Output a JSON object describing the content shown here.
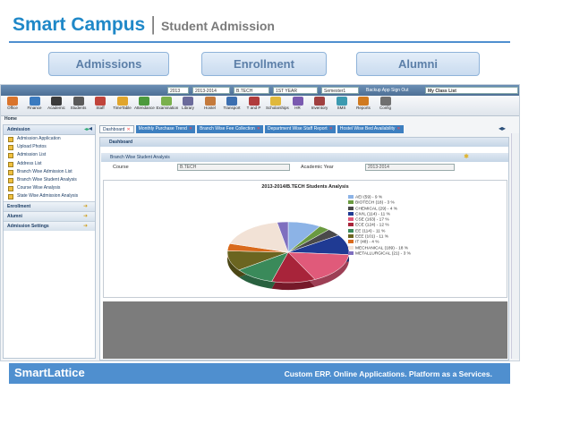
{
  "slide": {
    "brand": "Smart Campus",
    "separator": "|",
    "subtitle": "Student Admission",
    "pills": [
      "Admissions",
      "Enrollment",
      "Alumni"
    ],
    "footer_left": "SmartLattice",
    "footer_right": "Custom ERP. Online Applications. Platform as a Services."
  },
  "topbar": {
    "year1": "2013",
    "year2": "2013-2014",
    "course": "B.TECH",
    "year_level": "1ST YEAR",
    "semester": "Semester1",
    "backup": "Backup App",
    "signout": "Sign Out",
    "classlist": "My Class List"
  },
  "toolbar": [
    {
      "label": "Office",
      "color": "#d9742c"
    },
    {
      "label": "Finance",
      "color": "#3a7abf"
    },
    {
      "label": "Academic",
      "color": "#3b3b3b"
    },
    {
      "label": "Students",
      "color": "#5a5a5a"
    },
    {
      "label": "Staff",
      "color": "#c0443b"
    },
    {
      "label": "TimeTable",
      "color": "#e0a52c"
    },
    {
      "label": "Attendance",
      "color": "#4c9a3c"
    },
    {
      "label": "Examination",
      "color": "#7ab04c"
    },
    {
      "label": "Library",
      "color": "#6b6b9b"
    },
    {
      "label": "Hostel",
      "color": "#c47a3c"
    },
    {
      "label": "Transport",
      "color": "#3c6fb0"
    },
    {
      "label": "T and P",
      "color": "#b03c3c"
    },
    {
      "label": "Scholarships",
      "color": "#e0b83c"
    },
    {
      "label": "HR",
      "color": "#7a5ab0"
    },
    {
      "label": "Inventory",
      "color": "#a04040"
    },
    {
      "label": "SMS",
      "color": "#3c9ab0"
    },
    {
      "label": "Reports",
      "color": "#d07a20"
    },
    {
      "label": "Config",
      "color": "#707070"
    }
  ],
  "breadcrumb": "Home",
  "sidebar": {
    "header": "Admission",
    "items": [
      "Admission Application",
      "Upload Photos",
      "Admission List",
      "Address List",
      "Branch Wise Admission List",
      "Branch Wise Student Analysis",
      "Course Wise Analysis",
      "State Wise Admission Analysis"
    ],
    "groups": [
      "Enrollment",
      "Alumni",
      "Admission Settings"
    ]
  },
  "tabs": [
    {
      "label": "Dashboard",
      "active": true
    },
    {
      "label": "Monthly Purchase Trend",
      "active": false
    },
    {
      "label": "Branch Wise Fee Collection",
      "active": false
    },
    {
      "label": "Department Wise Staff Report",
      "active": false
    },
    {
      "label": "Hostel Wise Bed Availability",
      "active": false
    }
  ],
  "panel": {
    "dashboard": "Dashboard",
    "section": "Branch Wise Student Analysis",
    "course_label": "Course",
    "course_value": "B.TECH",
    "year_label": "Academic Year",
    "year_value": "2013-2014"
  },
  "chart_data": {
    "type": "pie",
    "title": "2013-2014/B.TECH Students Analysis",
    "slices": [
      {
        "label": "AEI (59) - 9 %",
        "value": 9,
        "color": "#8cb3e6"
      },
      {
        "label": "BIOTECH (18) - 3 %",
        "value": 3,
        "color": "#6a9a40"
      },
      {
        "label": "CHEMICAL (29) - 4 %",
        "value": 4,
        "color": "#4a4a4a"
      },
      {
        "label": "CIVIL (114) - 11 %",
        "value": 11,
        "color": "#1f3a93"
      },
      {
        "label": "CSE (163) - 17 %",
        "value": 17,
        "color": "#e05a7a"
      },
      {
        "label": "ECE (124) - 12 %",
        "value": 12,
        "color": "#a8243a"
      },
      {
        "label": "EE (114) - 11 %",
        "value": 11,
        "color": "#3a8a5a"
      },
      {
        "label": "EEE (101) - 11 %",
        "value": 11,
        "color": "#6b6520"
      },
      {
        "label": "IT (48) - 4 %",
        "value": 4,
        "color": "#d96a1c"
      },
      {
        "label": "MECHANICAL (189) - 18 %",
        "value": 18,
        "color": "#f2e2d6"
      },
      {
        "label": "METALLURGICAL (21) - 3 %",
        "value": 3,
        "color": "#7f6fbf"
      }
    ]
  }
}
